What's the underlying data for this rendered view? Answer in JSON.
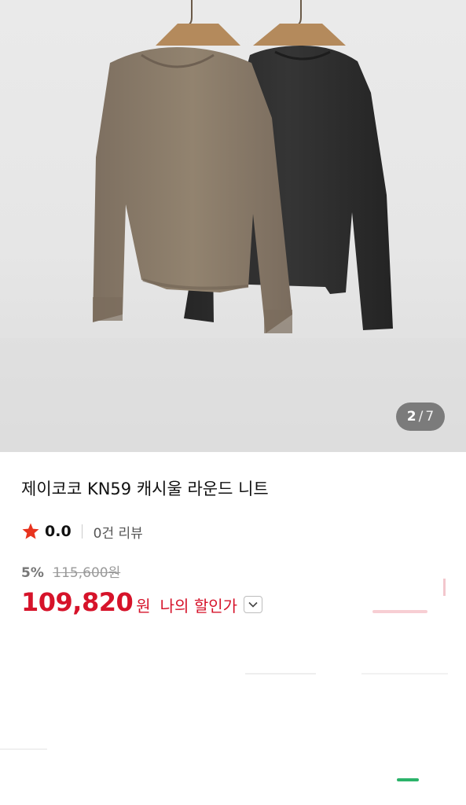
{
  "gallery": {
    "current": "2",
    "separator": "/",
    "total": "7"
  },
  "product": {
    "title": "제이코코 KN59 캐시울 라운드 니트",
    "rating": "0.0",
    "review_count": "0건 리뷰",
    "discount_rate": "5%",
    "original_price": "115,600원",
    "sale_price": "109,820",
    "currency": "원",
    "my_discount_label": "나의 할인가"
  },
  "colors": {
    "accent": "#d6132a",
    "star": "#e8331e",
    "sweater_left": "#8c7d6d",
    "sweater_right": "#2f2f2f"
  },
  "icons": {
    "rating": "star-icon",
    "dropdown": "chevron-down-icon"
  }
}
